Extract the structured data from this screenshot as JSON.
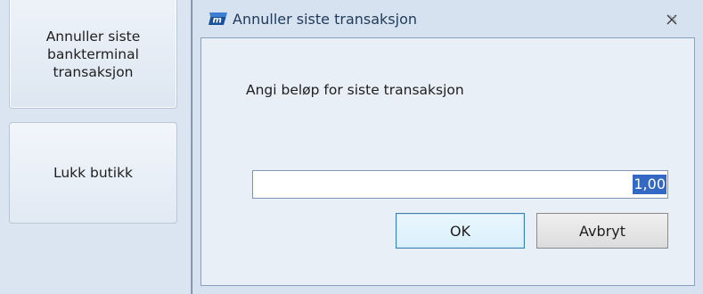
{
  "side_panel": {
    "buttons": [
      {
        "label": "Annuller siste\nbankterminal\ntransaksjon"
      },
      {
        "label": "Lukk butikk"
      }
    ]
  },
  "dialog": {
    "title": "Annuller siste transaksjon",
    "icon": "app-logo-icon",
    "close_icon": "close-icon",
    "prompt": "Angi beløp for siste transaksjon",
    "amount_value": "1,00",
    "ok_label": "OK",
    "cancel_label": "Avbryt"
  },
  "colors": {
    "accent": "#3369c2",
    "title_text": "#1e395b",
    "window_bg": "#d6e2ef"
  }
}
